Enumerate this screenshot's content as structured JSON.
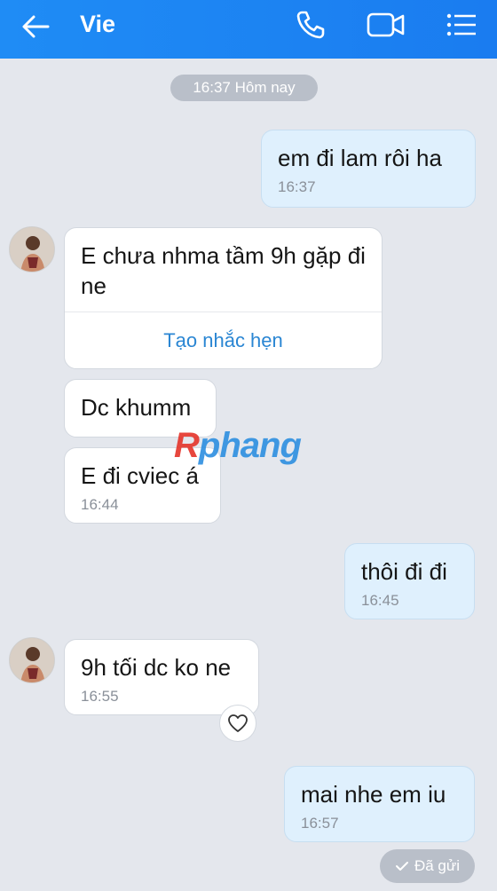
{
  "header": {
    "title": "Vie"
  },
  "date_separator": "16:37 Hôm nay",
  "messages": [
    {
      "side": "out",
      "text": "em đi lam rôi ha",
      "time": "16:37"
    },
    {
      "side": "in",
      "text": "E chưa nhma tầm 9h gặp đi ne",
      "action": "Tạo nhắc hẹn"
    },
    {
      "side": "in",
      "text": "Dc khumm"
    },
    {
      "side": "in",
      "text": "E đi cviec á",
      "time": "16:44"
    },
    {
      "side": "out",
      "text": "thôi đi đi",
      "time": "16:45"
    },
    {
      "side": "in",
      "text": "9h tối dc ko ne",
      "time": "16:55"
    },
    {
      "side": "out",
      "text": "mai nhe em iu",
      "time": "16:57"
    }
  ],
  "status": "Đã gửi",
  "watermark": {
    "part1": "R",
    "part2": "phang"
  },
  "colors": {
    "header": "#1a7cf0",
    "outgoing": "#dff0fd",
    "incoming": "#ffffff",
    "background": "#e4e7ed"
  }
}
